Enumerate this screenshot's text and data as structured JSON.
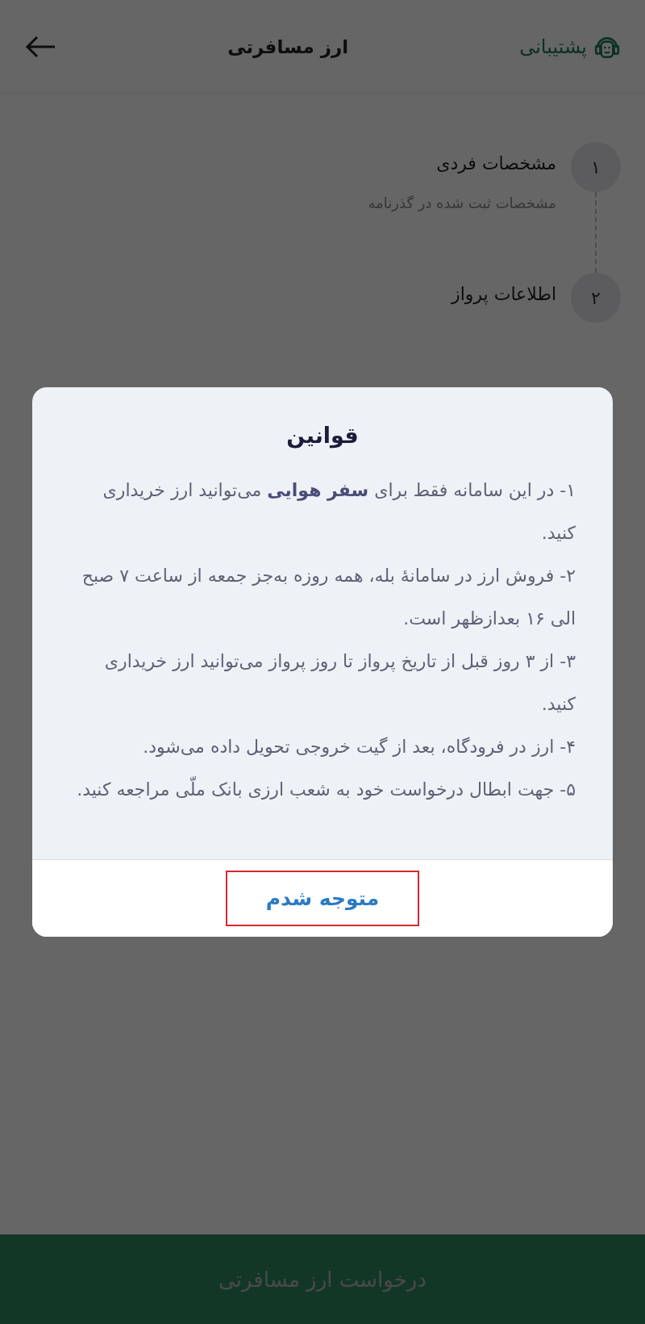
{
  "header": {
    "title": "ارز مسافرتی",
    "support_label": "پشتیبانی"
  },
  "steps": [
    {
      "number": "۱",
      "title": "مشخصات فردی",
      "subtitle": "مشخصات ثبت شده در گذرنامه"
    },
    {
      "number": "۲",
      "title": "اطلاعات پرواز"
    }
  ],
  "submit_button": {
    "label": "درخواست ارز مسافرتی",
    "disabled": true
  },
  "dialog": {
    "title": "قوانین",
    "rules": [
      "۱- در این سامانه فقط برای **سفر هوایی** می‌توانید ارز خریداری کنید.",
      "۲- فروش ارز در سامانهٔ بله، همه روزه به‌جز جمعه از ساعت ۷ صبح الی ۱۶ بعدازظهر است.",
      "۳- از ۳ روز قبل از تاریخ پرواز تا روز پرواز می‌توانید ارز خریداری کنید.",
      "۴- ارز در فرودگاه، بعد از گیت خروجی تحویل داده می‌شود.",
      "۵- جهت ابطال درخواست خود به شعب ارزی بانک ملّی مراجعه کنید."
    ],
    "confirm_button": {
      "label": "متوجه شدم",
      "highlighted": true
    }
  }
}
